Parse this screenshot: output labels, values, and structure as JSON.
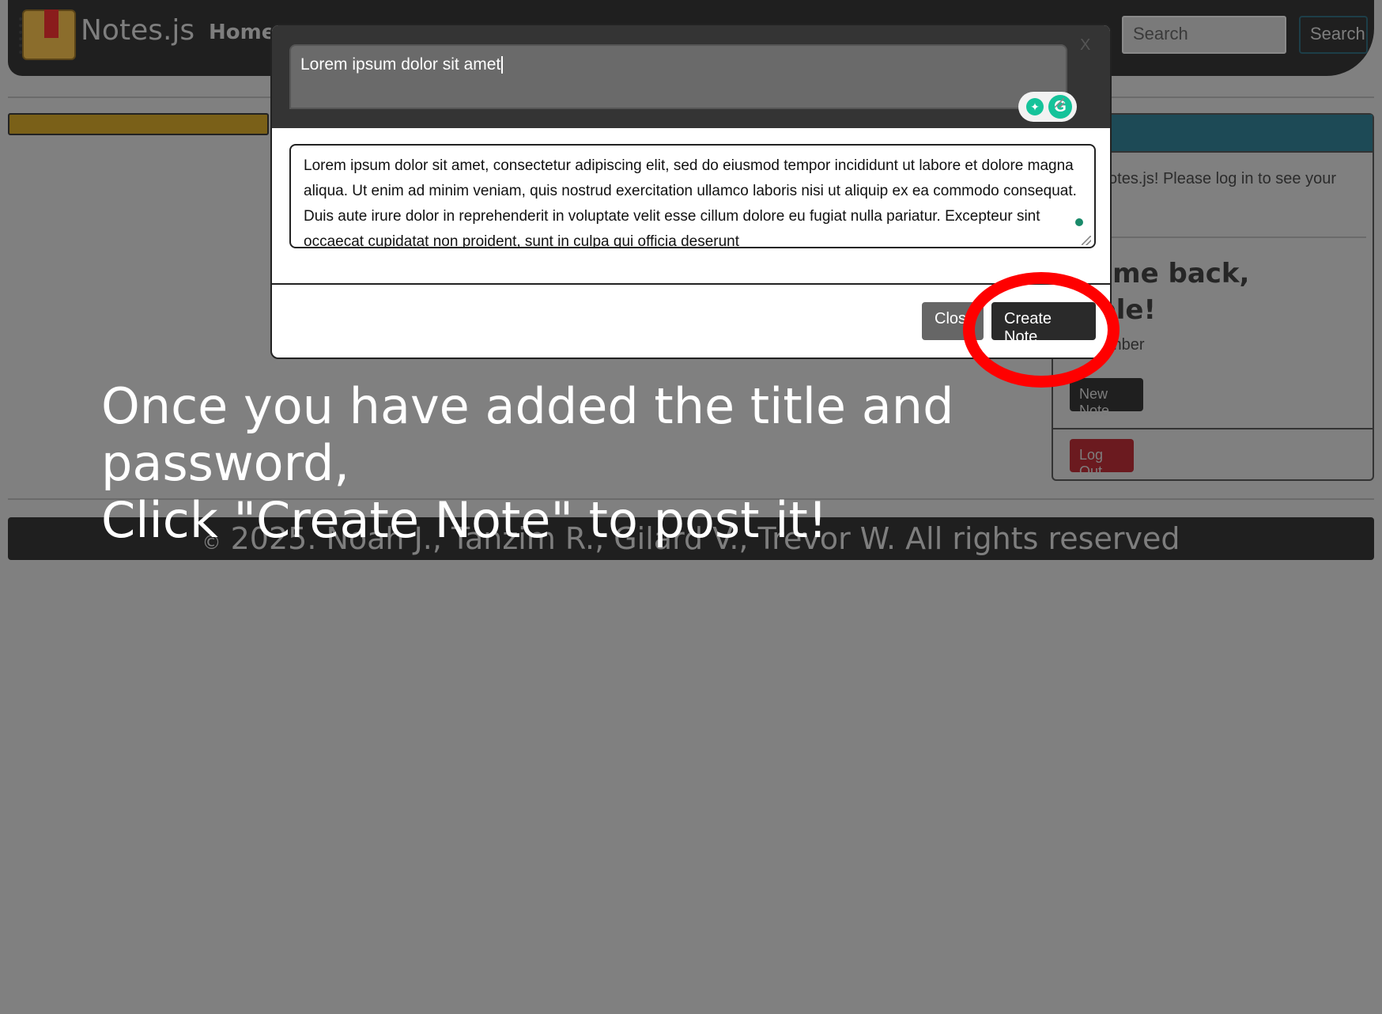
{
  "app": {
    "brand": "Notes.js",
    "nav": {
      "home": "Home"
    },
    "search": {
      "placeholder": "Search",
      "button": "Search"
    }
  },
  "sidebar_card": {
    "message": "e to notes.js! Please log in to see your",
    "welcome_line1": "lcome back,",
    "welcome_line2": "mple!",
    "role": "e: member",
    "new_note_button": "New Note",
    "logout_button": "Log Out"
  },
  "modal": {
    "title_value": "Lorem ipsum dolor sit amet",
    "body_value": "Lorem ipsum dolor sit amet, consectetur adipiscing elit, sed do eiusmod tempor incididunt ut labore et dolore magna aliqua. Ut enim ad minim veniam, quis nostrud exercitation ullamco laboris nisi ut aliquip ex ea commodo consequat. Duis aute irure dolor in reprehenderit in voluptate velit esse cillum dolore eu fugiat nulla pariatur. Excepteur sint occaecat cupidatat non proident, sunt in culpa qui officia deserunt",
    "close_x": "X",
    "close_button": "Close",
    "create_button": "Create Note"
  },
  "caption": {
    "line1": "Once you have added the title and password,",
    "line2": "Click \"Create Note\" to post it!"
  },
  "footer": {
    "copyright_symbol": "©",
    "text": "2025. Noah J., Tanzim R., Gilard V., Trevor W. All rights reserved"
  },
  "colors": {
    "overlay_gray": "#808080",
    "navbar": "#1f1f1f",
    "highlight": "#ff0000",
    "grammarly_green": "#15c39a"
  },
  "icons": [
    "notebook-logo-icon",
    "grammarly-bulb-icon",
    "grammarly-g-icon",
    "close-icon",
    "resize-grip-icon"
  ]
}
